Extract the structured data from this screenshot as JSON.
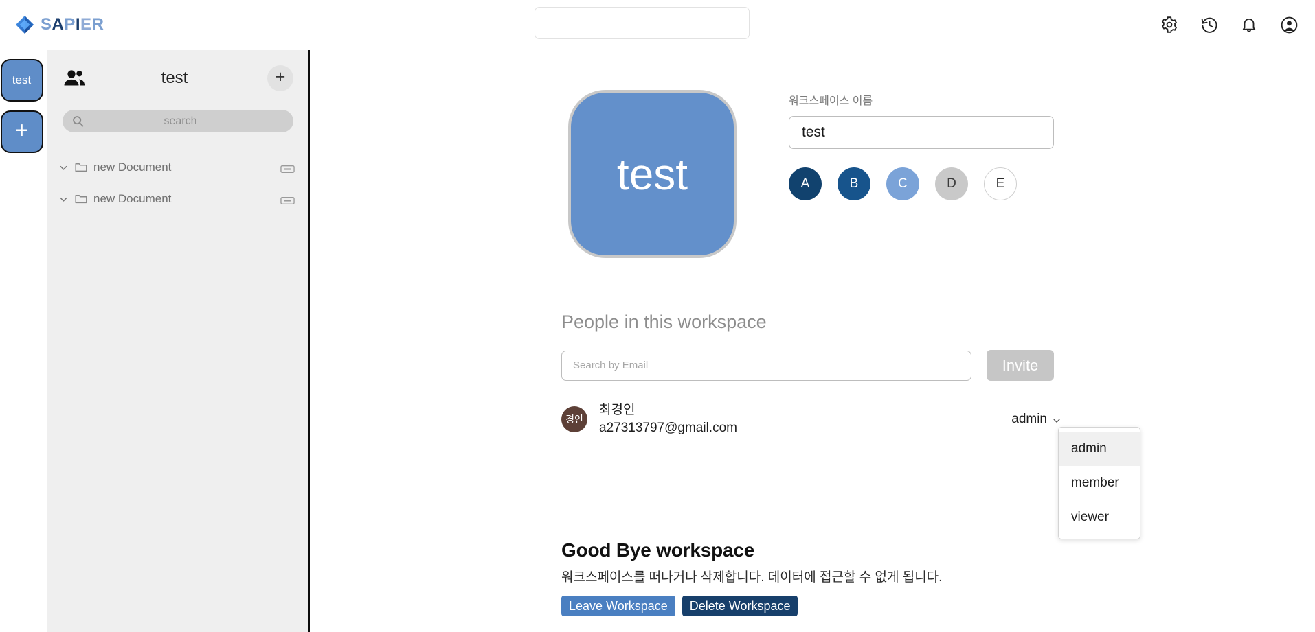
{
  "brand": {
    "name": "SAPIER",
    "logo_icon": "diamond-logo-icon"
  },
  "header": {
    "search_value": "",
    "search_placeholder": "",
    "icons": [
      {
        "name": "gear-icon",
        "label": "Settings"
      },
      {
        "name": "history-icon",
        "label": "History"
      },
      {
        "name": "bell-icon",
        "label": "Notifications"
      },
      {
        "name": "account-circle-icon",
        "label": "Account"
      }
    ]
  },
  "rail": {
    "workspaces": [
      {
        "label": "test",
        "color": "#5f8dc8"
      }
    ],
    "add_label": "+"
  },
  "sidebar": {
    "people_icon": "people-icon",
    "title": "test",
    "add_label": "+",
    "search_placeholder": "search",
    "search_icon": "magnifier-icon",
    "documents": [
      {
        "label": "new Document"
      },
      {
        "label": "new Document"
      }
    ]
  },
  "workspace": {
    "avatar_text": "test",
    "avatar_color": "#6390cb",
    "name_label": "워크스페이스 이름",
    "name_value": "test",
    "swatches": [
      {
        "letter": "A",
        "color": "#11426e",
        "text_color": "#ffffff",
        "selected": false
      },
      {
        "letter": "B",
        "color": "#17548c",
        "text_color": "#ffffff",
        "selected": false
      },
      {
        "letter": "C",
        "color": "#7ba3d8",
        "text_color": "#ffffff",
        "selected": true
      },
      {
        "letter": "D",
        "color": "#c9c9c9",
        "text_color": "#3a3a3a",
        "selected": false
      },
      {
        "letter": "E",
        "color": "#ffffff",
        "text_color": "#2a2a2a",
        "selected": false
      }
    ]
  },
  "people": {
    "section_title": "People in this workspace",
    "email_placeholder": "Search by Email",
    "email_value": "",
    "invite_label": "Invite",
    "members": [
      {
        "initials": "경인",
        "name": "최경인",
        "email": "a27313797@gmail.com",
        "role": "admin",
        "avatar_color": "#5d4037"
      }
    ],
    "role_menu": {
      "open": true,
      "options": [
        "admin",
        "member",
        "viewer"
      ],
      "selected": "admin"
    }
  },
  "goodbye": {
    "title": "Good Bye workspace",
    "description": "워크스페이스를 떠나거나 삭제합니다. 데이터에 접근할 수 없게 됩니다.",
    "leave_label": "Leave Workspace",
    "delete_label": "Delete Workspace",
    "leave_color": "#4a7fc1",
    "delete_color": "#173f6b"
  }
}
